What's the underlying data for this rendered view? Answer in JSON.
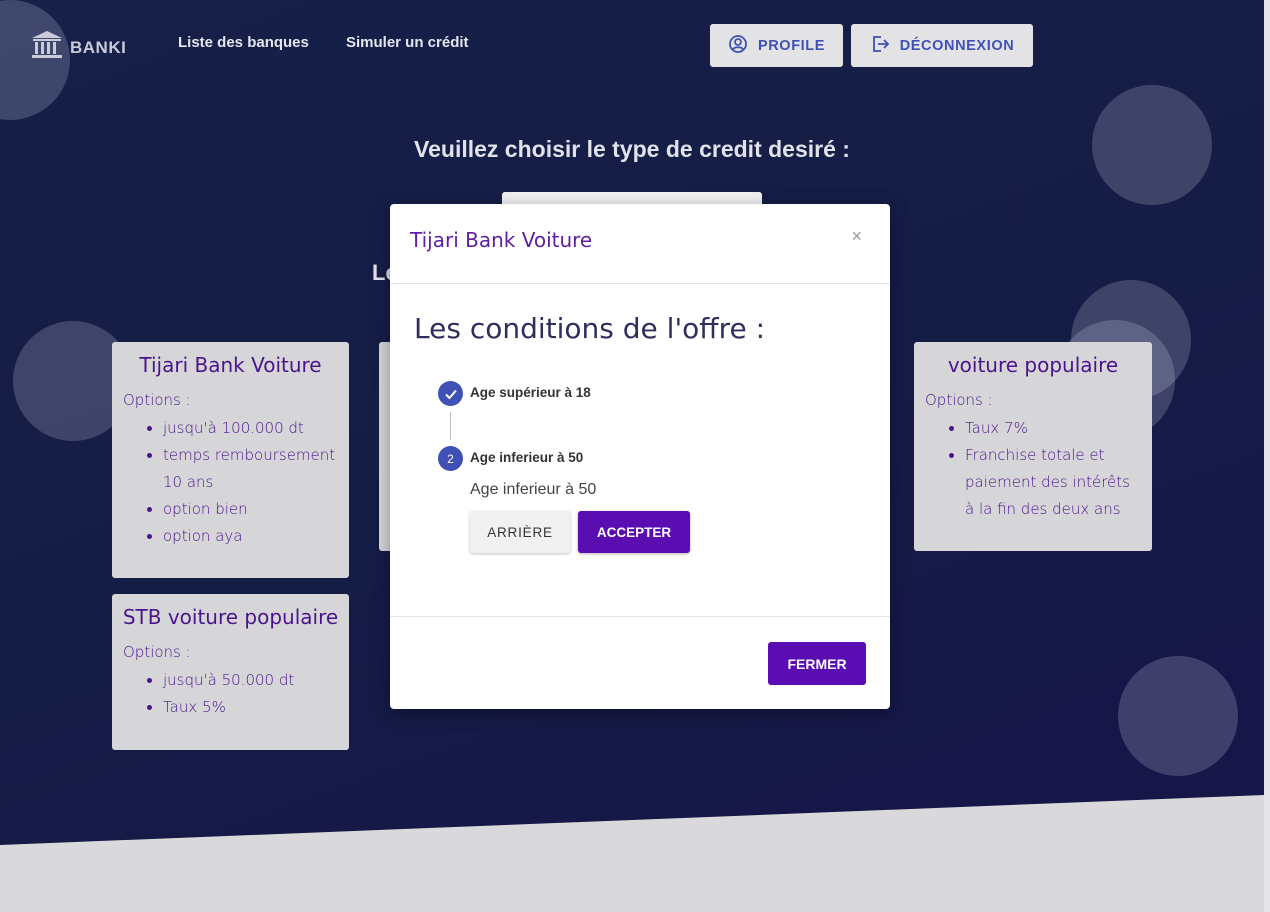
{
  "nav": {
    "logo_text": "BANKI",
    "links": [
      "Liste des banques",
      "Simuler un crédit"
    ],
    "profile_label": "PROFILE",
    "logout_label": "DÉCONNEXION"
  },
  "main": {
    "headline": "Veuillez choisir le type de credit desiré :",
    "sub_headline": "Le"
  },
  "cards": [
    {
      "title": "Tijari Bank Voiture",
      "options_label": "Options :",
      "items": [
        "jusqu'à 100.000 dt",
        "temps remboursement 10 ans",
        "option bien",
        "option aya"
      ]
    },
    {
      "title": "STB voiture populaire",
      "options_label": "Options :",
      "items": [
        "jusqu'à 50.000 dt",
        "Taux 5%"
      ]
    },
    {
      "title": "voiture populaire",
      "options_label": "Options :",
      "items": [
        "Taux 7%",
        "Franchise totale et paiement des intérêts à la fin des deux ans"
      ]
    }
  ],
  "modal": {
    "title": "Tijari Bank Voiture",
    "close_glyph": "×",
    "conditions_title": "Les conditions de l'offre :",
    "steps": [
      {
        "number": "1",
        "label": "Age supérieur à 18",
        "state": "completed"
      },
      {
        "number": "2",
        "label": "Age inferieur à 50",
        "state": "active"
      }
    ],
    "active_step_text": "Age inferieur à 50",
    "back_label": "ARRIÈRE",
    "accept_label": "ACCEPTER",
    "close_label": "FERMER"
  },
  "colors": {
    "hero_bg": "#172049",
    "accent_purple": "#5a0db0",
    "step_blue": "#3f51b5",
    "card_bg": "#d6d6d8"
  }
}
